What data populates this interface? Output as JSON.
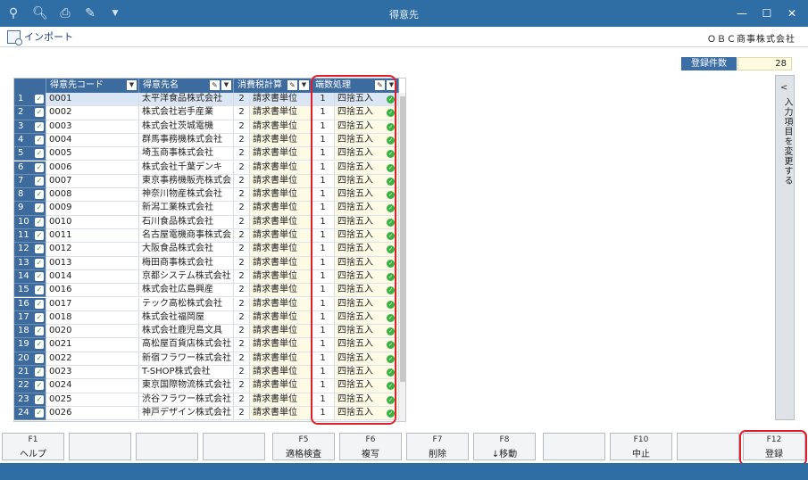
{
  "titlebar": {
    "title": "得意先",
    "icons": [
      "search-plus-icon",
      "magnifier-icon",
      "printer-icon",
      "tools-icon",
      "dropdown-icon"
    ],
    "win_buttons": {
      "minimize": "—",
      "maximize": "☐",
      "close": "✕"
    }
  },
  "menu": {
    "import_label": "インポート",
    "company": "ＯＢＣ商事株式会社"
  },
  "count": {
    "label": "登録件数",
    "value": "28"
  },
  "side_panel": {
    "label": "入力項目を変更する",
    "chevron": "<"
  },
  "grid": {
    "headers": {
      "code": "得意先コード",
      "name": "得意先名",
      "tax": "消費税計算",
      "rounding": "端数処理"
    },
    "rows": [
      {
        "n": "1",
        "code": "0001",
        "name": "太平洋食品株式会社",
        "tax_num": "2",
        "tax": "請求書単位",
        "r_num": "1",
        "r": "四捨五入"
      },
      {
        "n": "2",
        "code": "0002",
        "name": "株式会社岩手産業",
        "tax_num": "2",
        "tax": "請求書単位",
        "r_num": "1",
        "r": "四捨五入"
      },
      {
        "n": "3",
        "code": "0003",
        "name": "株式会社茨城電機",
        "tax_num": "2",
        "tax": "請求書単位",
        "r_num": "1",
        "r": "四捨五入"
      },
      {
        "n": "4",
        "code": "0004",
        "name": "群馬事務機株式会社",
        "tax_num": "2",
        "tax": "請求書単位",
        "r_num": "1",
        "r": "四捨五入"
      },
      {
        "n": "5",
        "code": "0005",
        "name": "埼玉商事株式会社",
        "tax_num": "2",
        "tax": "請求書単位",
        "r_num": "1",
        "r": "四捨五入"
      },
      {
        "n": "6",
        "code": "0006",
        "name": "株式会社千葉デンキ",
        "tax_num": "2",
        "tax": "請求書単位",
        "r_num": "1",
        "r": "四捨五入"
      },
      {
        "n": "7",
        "code": "0007",
        "name": "東京事務機販売株式会",
        "tax_num": "2",
        "tax": "請求書単位",
        "r_num": "1",
        "r": "四捨五入"
      },
      {
        "n": "8",
        "code": "0008",
        "name": "神奈川物産株式会社",
        "tax_num": "2",
        "tax": "請求書単位",
        "r_num": "1",
        "r": "四捨五入"
      },
      {
        "n": "9",
        "code": "0009",
        "name": "新潟工業株式会社",
        "tax_num": "2",
        "tax": "請求書単位",
        "r_num": "1",
        "r": "四捨五入"
      },
      {
        "n": "10",
        "code": "0010",
        "name": "石川食品株式会社",
        "tax_num": "2",
        "tax": "請求書単位",
        "r_num": "1",
        "r": "四捨五入"
      },
      {
        "n": "11",
        "code": "0011",
        "name": "名古屋電機商事株式会",
        "tax_num": "2",
        "tax": "請求書単位",
        "r_num": "1",
        "r": "四捨五入"
      },
      {
        "n": "12",
        "code": "0012",
        "name": "大阪食品株式会社",
        "tax_num": "2",
        "tax": "請求書単位",
        "r_num": "1",
        "r": "四捨五入"
      },
      {
        "n": "13",
        "code": "0013",
        "name": "梅田商事株式会社",
        "tax_num": "2",
        "tax": "請求書単位",
        "r_num": "1",
        "r": "四捨五入"
      },
      {
        "n": "14",
        "code": "0014",
        "name": "京都システム株式会社",
        "tax_num": "2",
        "tax": "請求書単位",
        "r_num": "1",
        "r": "四捨五入"
      },
      {
        "n": "15",
        "code": "0016",
        "name": "株式会社広島興産",
        "tax_num": "2",
        "tax": "請求書単位",
        "r_num": "1",
        "r": "四捨五入"
      },
      {
        "n": "16",
        "code": "0017",
        "name": "テック高松株式会社",
        "tax_num": "2",
        "tax": "請求書単位",
        "r_num": "1",
        "r": "四捨五入"
      },
      {
        "n": "17",
        "code": "0018",
        "name": "株式会社福岡屋",
        "tax_num": "2",
        "tax": "請求書単位",
        "r_num": "1",
        "r": "四捨五入"
      },
      {
        "n": "18",
        "code": "0020",
        "name": "株式会社鹿児島文具",
        "tax_num": "2",
        "tax": "請求書単位",
        "r_num": "1",
        "r": "四捨五入"
      },
      {
        "n": "19",
        "code": "0021",
        "name": "高松屋百貨店株式会社",
        "tax_num": "2",
        "tax": "請求書単位",
        "r_num": "1",
        "r": "四捨五入"
      },
      {
        "n": "20",
        "code": "0022",
        "name": "新宿フラワー株式会社",
        "tax_num": "2",
        "tax": "請求書単位",
        "r_num": "1",
        "r": "四捨五入"
      },
      {
        "n": "21",
        "code": "0023",
        "name": "T-SHOP株式会社",
        "tax_num": "2",
        "tax": "請求書単位",
        "r_num": "1",
        "r": "四捨五入"
      },
      {
        "n": "22",
        "code": "0024",
        "name": "東京国際物流株式会社",
        "tax_num": "2",
        "tax": "請求書単位",
        "r_num": "1",
        "r": "四捨五入"
      },
      {
        "n": "23",
        "code": "0025",
        "name": "渋谷フラワー株式会社",
        "tax_num": "2",
        "tax": "請求書単位",
        "r_num": "1",
        "r": "四捨五入"
      },
      {
        "n": "24",
        "code": "0026",
        "name": "神戸デザイン株式会社",
        "tax_num": "2",
        "tax": "請求書単位",
        "r_num": "1",
        "r": "四捨五入"
      }
    ]
  },
  "fkeys": [
    {
      "key": "F1",
      "label": "ヘルプ"
    },
    {
      "key": "",
      "label": ""
    },
    {
      "key": "",
      "label": ""
    },
    {
      "key": "",
      "label": ""
    },
    {
      "key": "F5",
      "label": "適格検査"
    },
    {
      "key": "F6",
      "label": "複写"
    },
    {
      "key": "F7",
      "label": "削除"
    },
    {
      "key": "F8",
      "label": "↓移動"
    },
    {
      "key": "",
      "label": ""
    },
    {
      "key": "F10",
      "label": "中止"
    },
    {
      "key": "",
      "label": ""
    },
    {
      "key": "F12",
      "label": "登録"
    }
  ],
  "colors": {
    "accent": "#2f6ea5",
    "header": "#3d6b9e",
    "highlight": "#e21d2a",
    "ok_green": "#3cb043"
  }
}
